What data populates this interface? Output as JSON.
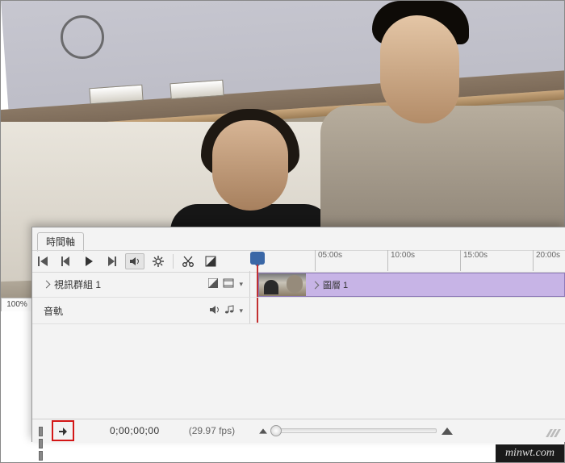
{
  "panel": {
    "tab_label": "時間軸"
  },
  "ruler": {
    "marks": [
      "05:00s",
      "10:00s",
      "15:00s",
      "20:00s"
    ]
  },
  "tracks": {
    "video": {
      "name": "視訊群組 1",
      "filmstrip_icon": "filmstrip-icon",
      "transition_icon": "transition-icon"
    },
    "audio": {
      "name": "音軌",
      "speaker_icon": "speaker-icon",
      "note_icon": "music-note-icon"
    }
  },
  "clip": {
    "label": "圖層 1"
  },
  "footer": {
    "timecode": "0;00;00;00",
    "fps": "(29.97 fps)"
  },
  "zoom_tab": "100%",
  "watermark": "minwt.com"
}
